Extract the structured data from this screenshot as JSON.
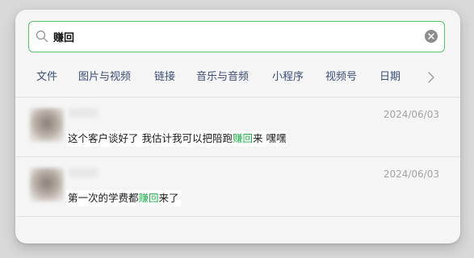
{
  "search": {
    "value": "赚回",
    "icon": "search-icon",
    "clear_icon": "clear-icon"
  },
  "tabs": [
    {
      "label": "文件"
    },
    {
      "label": "图片与视频"
    },
    {
      "label": "链接"
    },
    {
      "label": "音乐与音频"
    },
    {
      "label": "小程序"
    },
    {
      "label": "视频号"
    },
    {
      "label": "日期"
    }
  ],
  "tabs_next_icon": "chevron-right-icon",
  "results": [
    {
      "date": "2024/06/03",
      "message_before": "这个客户谈好了 我估计我可以把陪跑",
      "message_highlight": "赚回",
      "message_after": "来  嘿嘿"
    },
    {
      "date": "2024/06/03",
      "message_before": "第一次的学费都",
      "message_highlight": "赚回",
      "message_after": "来了"
    }
  ],
  "colors": {
    "accent_border": "#55c26a",
    "highlight": "#20b04b",
    "tab_text": "#3c4f78",
    "date_text": "#a3a3a3"
  }
}
